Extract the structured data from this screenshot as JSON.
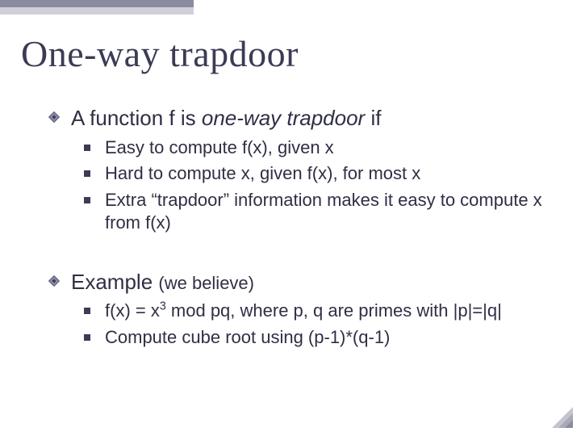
{
  "title": "One-way trapdoor",
  "section1": {
    "lead_pre": "A function f is ",
    "lead_italic": "one-way trapdoor",
    "lead_post": " if",
    "items": [
      "Easy to compute f(x), given x",
      "Hard to compute x, given f(x), for most x",
      "Extra “trapdoor” information makes it easy to compute x from f(x)"
    ]
  },
  "section2": {
    "lead_main": "Example ",
    "lead_paren": "(we believe)",
    "items_a_pre": "f(x) = x",
    "items_a_sup": "3",
    "items_a_post": " mod pq, where p, q are primes with |p|=|q|",
    "items_b": "Compute cube root using (p-1)*(q-1)"
  },
  "colors": {
    "diamond_outer": "#5a5a7a",
    "diamond_inner": "#8b8ba8",
    "corner_a": "#a8a8b8",
    "corner_b": "#c4c4d0"
  }
}
